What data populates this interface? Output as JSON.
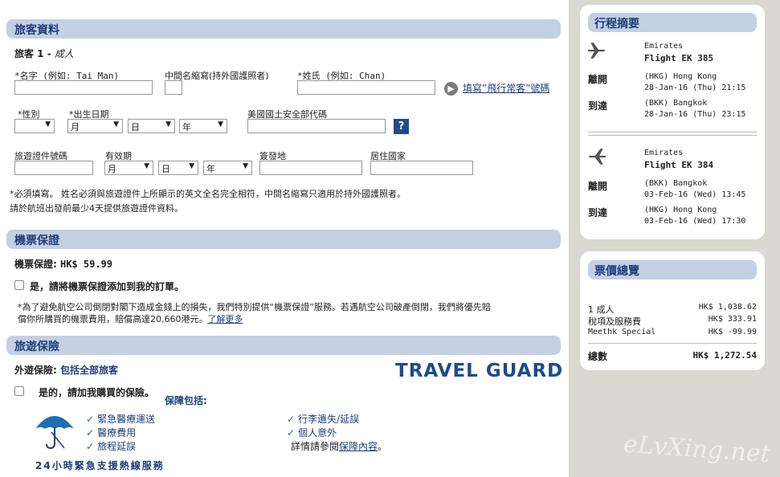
{
  "passenger": {
    "section_title": "旅客資料",
    "passenger_label": "旅客 1 - ",
    "passenger_type": "成人",
    "given_name_label": "*名字 (例如: Tai Man)",
    "middle_name_label": "中間名縮寫(持外國護照者)",
    "surname_label": "*姓氏 (例如: Chan)",
    "frequent_flyer_link": "填寫”飛行常客”號碼",
    "gender_label": "*性別",
    "dob_label": "*出生日期",
    "month_option": "月",
    "day_option": "日",
    "year_option": "年",
    "us_security_label": "美國國土安全部代碼",
    "help_icon": "?",
    "doc_number_label": "旅遊證件號碼",
    "expiry_label": "有效期",
    "issued_at_label": "簽發地",
    "residence_label": "居住國家",
    "note1": "*必須填寫。 姓名必須與旅遊證件上所顯示的英文全名完全相符，中間名縮寫只適用於持外國護照者。",
    "note2": "請於航班出發前最少4天提供旅遊證件資料。"
  },
  "ticket_protection": {
    "section_title": "機票保證",
    "price_label": "機票保證: ",
    "price_value": "HK$ 59.99",
    "checkbox_label": "是，請將機票保證添加到我的訂單。",
    "desc1": "*為了避免航空公司倒閉對閣下造成金錢上的損失，我們特別提供“機票保證”服務。若遇航空公司破產倒閉，我們將優先賠",
    "desc2": "償你所購買的機票費用，賠償高達20,660港元。",
    "learn_more": "了解更多"
  },
  "insurance": {
    "section_title": "旅遊保險",
    "outbound_label": "外遊保險: ",
    "outbound_value": "包括全部旅客",
    "brand": "TRAVEL GUARD",
    "checkbox_label": "是的，請加我購買的保險。",
    "coverage_title": "保障包括:",
    "coverage_left": [
      "緊急醫療運送",
      "醫療費用",
      "旅程延誤"
    ],
    "coverage_right": [
      "行李遺失/延誤",
      "個人意外"
    ],
    "details_text": "詳情請參閱",
    "details_link": "保障內容",
    "details_end": "。",
    "hotline": "24小時緊急支援熱線服務"
  },
  "itinerary": {
    "title": "行程摘要",
    "flights": [
      {
        "airline": "Emirates",
        "flight": "Flight EK 385",
        "depart_label": "離開",
        "depart_place": "(HKG) Hong Kong",
        "depart_time": "28-Jan-16 (Thu) 21:15",
        "arrive_label": "到達",
        "arrive_place": "(BKK) Bangkok",
        "arrive_time": "28-Jan-16 (Thu) 23:15"
      },
      {
        "airline": "Emirates",
        "flight": "Flight EK 384",
        "depart_label": "離開",
        "depart_place": "(BKK) Bangkok",
        "depart_time": "03-Feb-16 (Wed) 13:45",
        "arrive_label": "到達",
        "arrive_place": "(HKG) Hong Kong",
        "arrive_time": "03-Feb-16 (Wed) 17:30"
      }
    ]
  },
  "fare": {
    "title": "票價總覽",
    "rows": [
      {
        "label": "1 成人",
        "value": "HK$ 1,038.62"
      },
      {
        "label": "稅項及服務費",
        "value": "HK$ 333.91"
      },
      {
        "label": "Meethk Special",
        "value": "HK$ -99.99"
      }
    ],
    "total_label": "總數",
    "total_value": "HK$ 1,272.54"
  },
  "watermark": "eLvXing.net"
}
